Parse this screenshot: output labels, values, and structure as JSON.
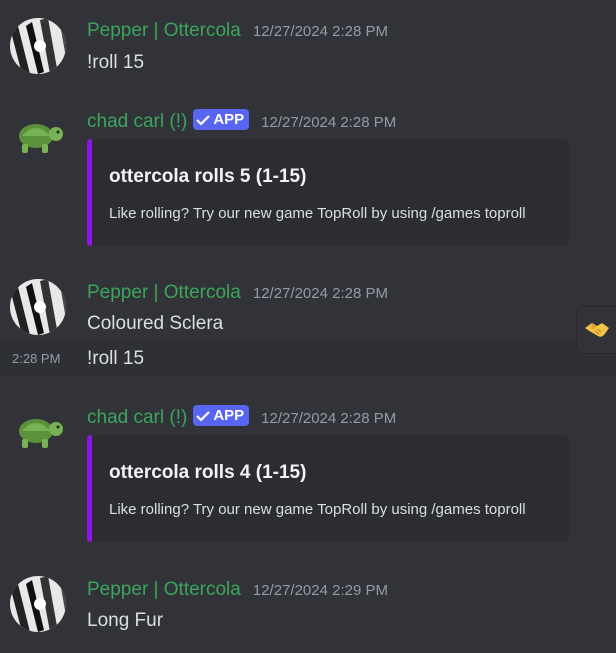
{
  "messages": [
    {
      "username": "Pepper | Ottercola",
      "timestamp": "12/27/2024 2:28 PM",
      "text": "!roll 15"
    },
    {
      "username": "chad carl (!)",
      "badge": "APP",
      "timestamp": "12/27/2024 2:28 PM",
      "embed": {
        "title": "ottercola rolls 5 (1-15)",
        "description": "Like rolling? Try our new game TopRoll by using /games toproll"
      }
    },
    {
      "username": "Pepper | Ottercola",
      "timestamp": "12/27/2024 2:28 PM",
      "text": "Coloured Sclera"
    },
    {
      "side_timestamp": "2:28 PM",
      "text": "!roll 15"
    },
    {
      "username": "chad carl (!)",
      "badge": "APP",
      "timestamp": "12/27/2024 2:28 PM",
      "embed": {
        "title": "ottercola rolls 4 (1-15)",
        "description": "Like rolling? Try our new game TopRoll by using /games toproll"
      }
    },
    {
      "username": "Pepper | Ottercola",
      "timestamp": "12/27/2024 2:29 PM",
      "text": "Long Fur"
    }
  ],
  "colors": {
    "background": "#313338",
    "username": "#3ba55c",
    "embed_accent": "#8c16e6",
    "app_badge": "#5865f2"
  },
  "reaction_icon": "handshake-icon"
}
